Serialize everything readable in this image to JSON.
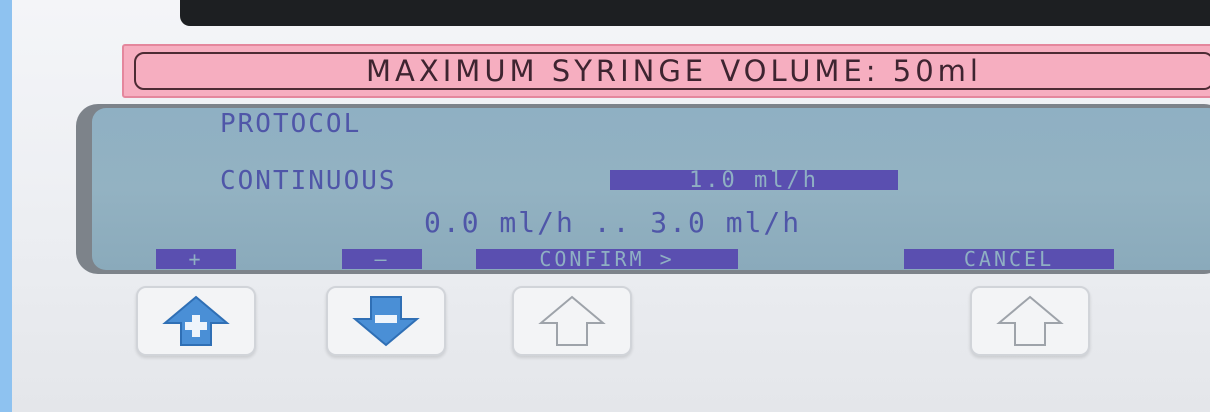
{
  "label": {
    "text": "MAXIMUM SYRINGE VOLUME: 50ml"
  },
  "screen": {
    "title": "PROTOCOL",
    "mode": "CONTINUOUS",
    "rate": "1.0 ml/h",
    "range": "0.0 ml/h   .. 3.0 ml/h"
  },
  "softkeys": {
    "plus": "+",
    "minus": "—",
    "confirm": "CONFIRM >",
    "cancel": "CANCEL"
  },
  "icons": {
    "up": "plus-up-arrow-icon",
    "down": "minus-down-arrow-icon",
    "confirm": "up-arrow-outline-icon",
    "cancel": "up-arrow-outline-icon"
  },
  "colors": {
    "lcd_background": "#8fb0c3",
    "lcd_text": "#4f56a8",
    "label_pink": "#f6aec0",
    "button_arrow_blue": "#4a8fd6"
  }
}
